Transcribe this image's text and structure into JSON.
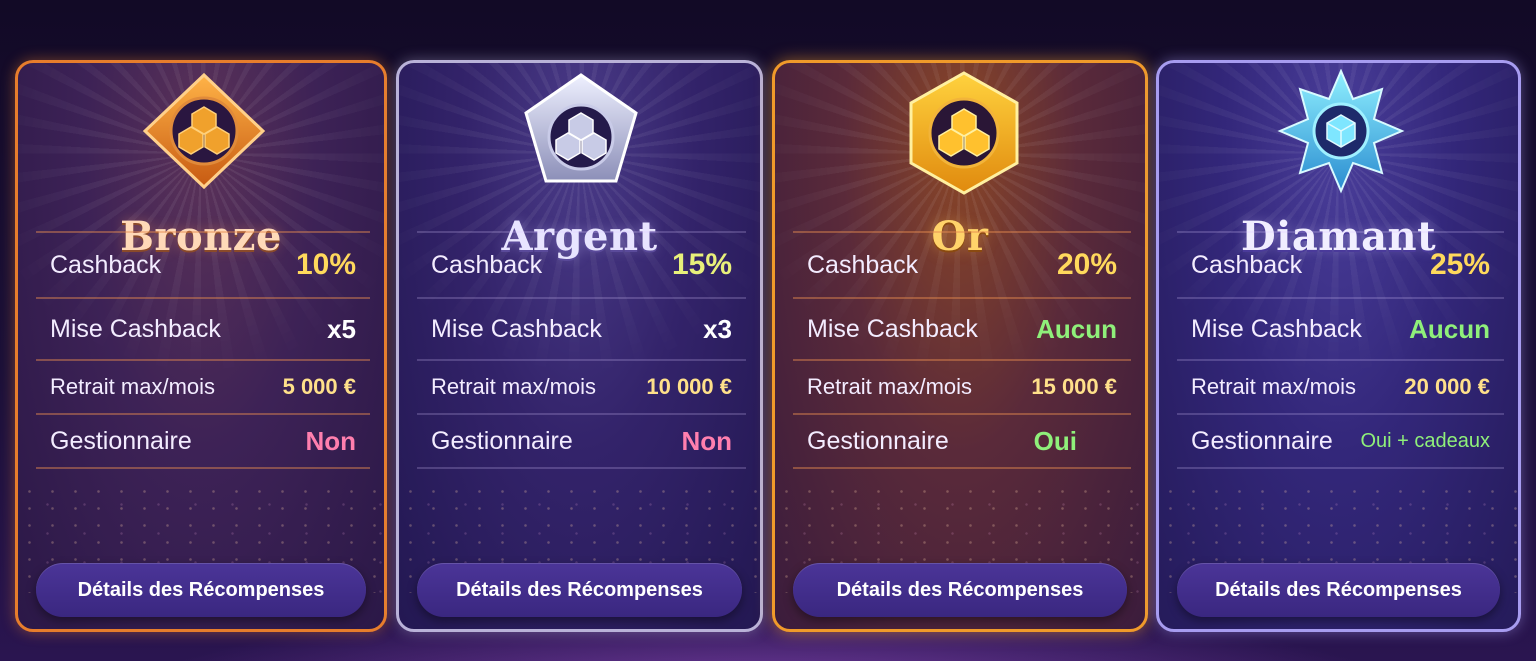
{
  "tiers": [
    {
      "name": "Bronze",
      "badge_icon": "bronze-cubes-badge-icon",
      "accent": "#e77d2c",
      "rows": [
        {
          "label": "Cashback",
          "value": "10%"
        },
        {
          "label": "Mise Cashback",
          "value": "x5"
        },
        {
          "label": "Retrait max/mois",
          "value": "5 000 €"
        },
        {
          "label": "Gestionnaire",
          "value": "Non"
        }
      ],
      "button": "Détails des Récompenses"
    },
    {
      "name": "Argent",
      "badge_icon": "silver-cubes-badge-icon",
      "accent": "#b9b2d8",
      "rows": [
        {
          "label": "Cashback",
          "value": "15%"
        },
        {
          "label": "Mise Cashback",
          "value": "x3"
        },
        {
          "label": "Retrait max/mois",
          "value": "10 000 €"
        },
        {
          "label": "Gestionnaire",
          "value": "Non"
        }
      ],
      "button": "Détails des Récompenses"
    },
    {
      "name": "Or",
      "badge_icon": "gold-cubes-badge-icon",
      "accent": "#f09a2a",
      "rows": [
        {
          "label": "Cashback",
          "value": "20%"
        },
        {
          "label": "Mise Cashback",
          "value": "Aucun"
        },
        {
          "label": "Retrait max/mois",
          "value": "15 000 €"
        },
        {
          "label": "Gestionnaire",
          "value": "Oui"
        }
      ],
      "button": "Détails des Récompenses"
    },
    {
      "name": "Diamant",
      "badge_icon": "diamond-star-badge-icon",
      "accent": "#a79cf0",
      "rows": [
        {
          "label": "Cashback",
          "value": "25%"
        },
        {
          "label": "Mise Cashback",
          "value": "Aucun"
        },
        {
          "label": "Retrait max/mois",
          "value": "20 000 €"
        },
        {
          "label": "Gestionnaire",
          "value": "Oui + cadeaux"
        }
      ],
      "button": "Détails des Récompenses"
    }
  ],
  "colors": {
    "value_gold": "#ffd95c",
    "value_green": "#8ff07a",
    "value_pink": "#ff7fae",
    "value_white": "#ffffff"
  }
}
